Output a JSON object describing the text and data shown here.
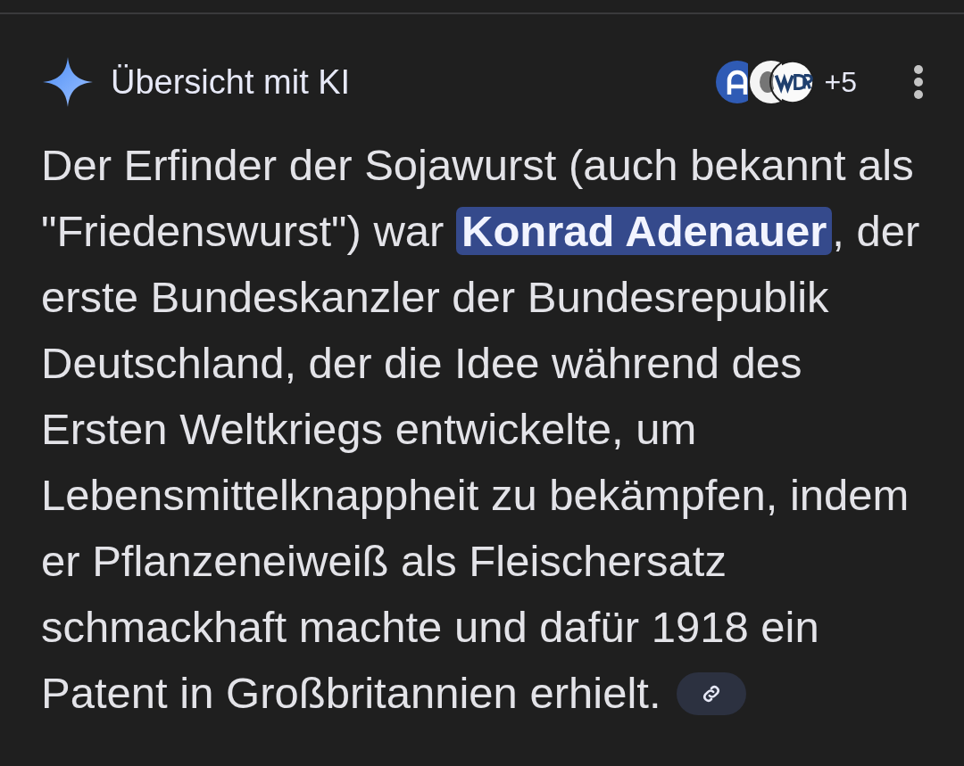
{
  "header": {
    "title": "Übersicht mit KI",
    "sources_more": "+5"
  },
  "answer": {
    "text": "Der Erfinder der Sojawurst (auch bekannt als \"Friedenswurst\") war **Konrad Adenauer**, der erste Bundeskanzler der Bundesrepublik Deutschland, der die Idee während des Ersten Weltkriegs entwickelte, um Lebensmittelknappheit zu bekämpfen, indem er Pflanzeneiweiß als Fleischersatz schmackhaft machte und dafür 1918 ein Patent in Großbritannien erhielt."
  }
}
